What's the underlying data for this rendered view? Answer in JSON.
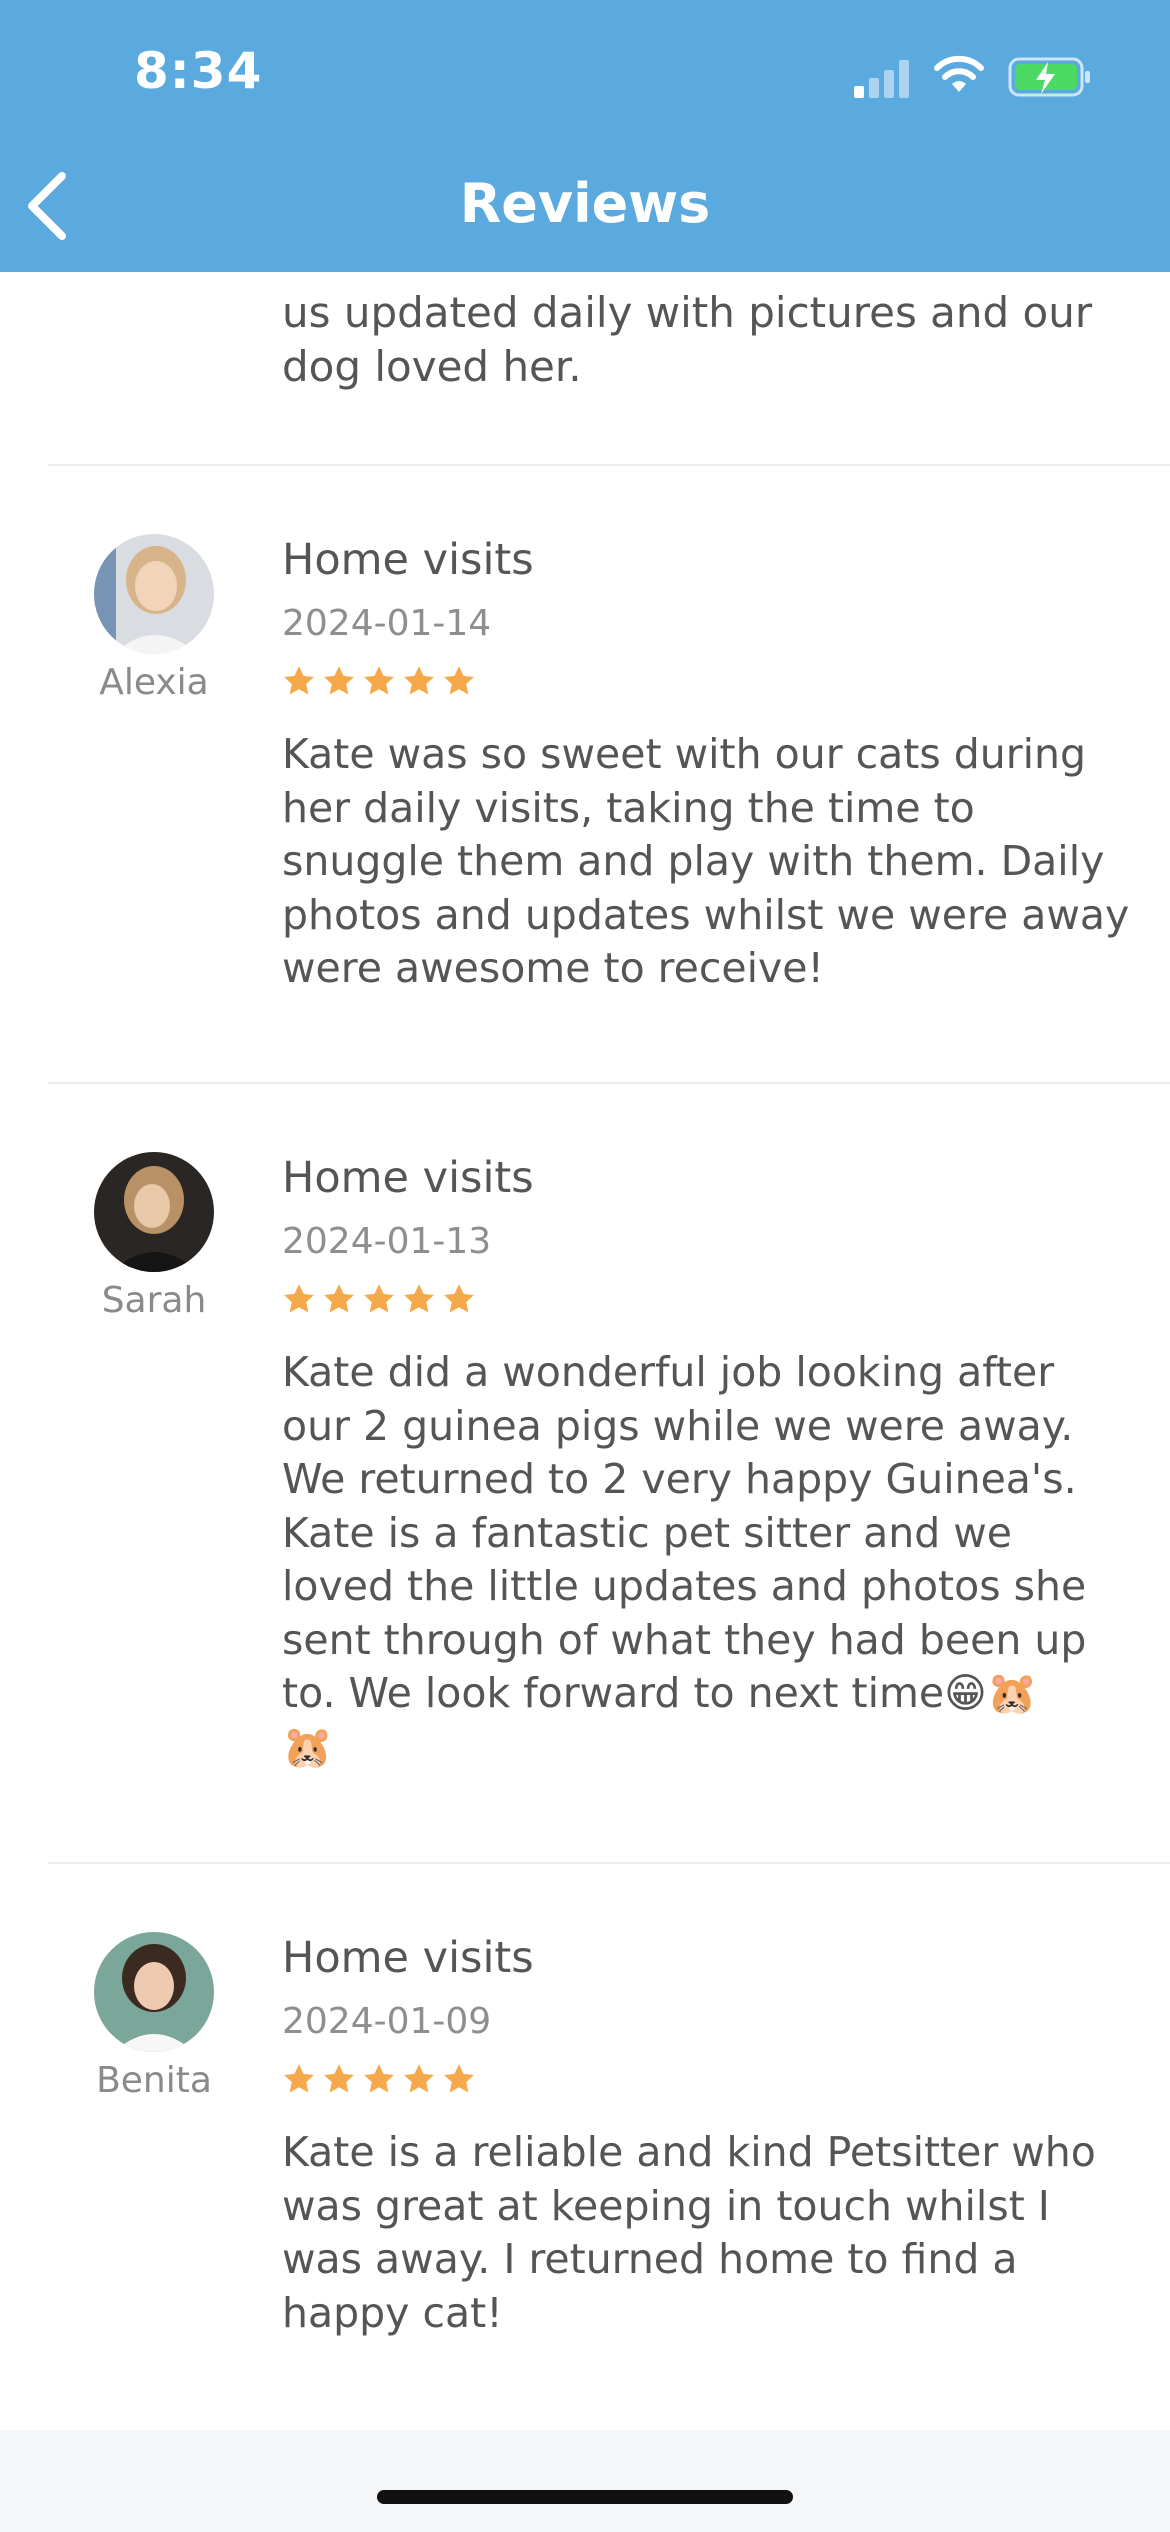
{
  "status_bar": {
    "time": "8:34"
  },
  "nav": {
    "title": "Reviews"
  },
  "partial_review": {
    "lines": [
      "us updated daily with pictures and our",
      "dog loved her."
    ]
  },
  "reviews": [
    {
      "user": "Alexia",
      "service": "Home visits",
      "date": "2024-01-14",
      "rating": 5,
      "text": "Kate was so sweet with our cats during\nher daily visits,  taking the time to\nsnuggle them and play with them.  Daily\nphotos and updates whilst we were away\nwere awesome to receive!"
    },
    {
      "user": "Sarah",
      "service": "Home visits",
      "date": "2024-01-13",
      "rating": 5,
      "text": "Kate did a wonderful job looking after\nour 2 guinea pigs while we were away.\nWe returned to 2 very happy Guinea's.\nKate is a fantastic pet sitter and we\nloved the little updates and photos she\nsent through of what they had been up\nto. We look forward to next time😁🐹\n🐹"
    },
    {
      "user": "Benita",
      "service": "Home visits",
      "date": "2024-01-09",
      "rating": 5,
      "text": "Kate is a reliable and kind Petsitter who\nwas great at keeping in touch whilst I\nwas away. I returned home to find a\nhappy cat!"
    }
  ],
  "colors": {
    "header": "#5aa9df",
    "star": "#f5a94a",
    "battery_fill": "#4cd964"
  }
}
